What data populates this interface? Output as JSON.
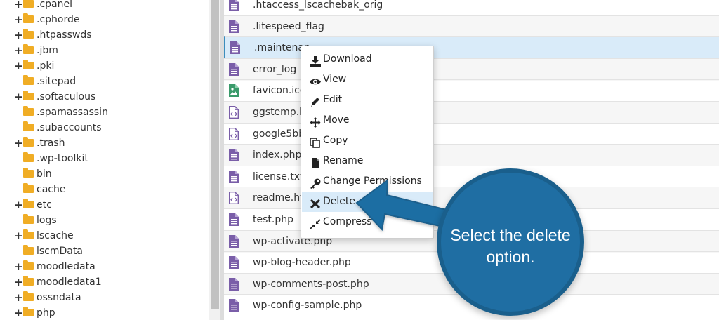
{
  "tree": {
    "items": [
      {
        "label": ".cpanel",
        "expandable": true
      },
      {
        "label": ".cphorde",
        "expandable": true
      },
      {
        "label": ".htpasswds",
        "expandable": true
      },
      {
        "label": ".jbm",
        "expandable": true
      },
      {
        "label": ".pki",
        "expandable": true
      },
      {
        "label": ".sitepad",
        "expandable": false
      },
      {
        "label": ".softaculous",
        "expandable": true
      },
      {
        "label": ".spamassassin",
        "expandable": false
      },
      {
        "label": ".subaccounts",
        "expandable": false
      },
      {
        "label": ".trash",
        "expandable": true
      },
      {
        "label": ".wp-toolkit",
        "expandable": false
      },
      {
        "label": "bin",
        "expandable": false
      },
      {
        "label": "cache",
        "expandable": false
      },
      {
        "label": "etc",
        "expandable": true
      },
      {
        "label": "logs",
        "expandable": false
      },
      {
        "label": "lscache",
        "expandable": true
      },
      {
        "label": "lscmData",
        "expandable": false
      },
      {
        "label": "moodledata",
        "expandable": true
      },
      {
        "label": "moodledata1",
        "expandable": true
      },
      {
        "label": "ossndata",
        "expandable": true
      },
      {
        "label": "php",
        "expandable": true
      }
    ],
    "expand_glyph": "+"
  },
  "files": [
    {
      "name": ".htaccess_lscachebak_orig",
      "icon": "text-file-icon"
    },
    {
      "name": ".litespeed_flag",
      "icon": "text-file-icon"
    },
    {
      "name": ".maintenan",
      "icon": "text-file-icon",
      "selected": true
    },
    {
      "name": "error_log",
      "icon": "text-file-icon"
    },
    {
      "name": "favicon.ico",
      "icon": "image-file-icon"
    },
    {
      "name": "ggstemp.ht",
      "icon": "code-file-icon"
    },
    {
      "name": "google5bb4",
      "icon": "code-file-icon"
    },
    {
      "name": "index.php",
      "icon": "text-file-icon"
    },
    {
      "name": "license.txt",
      "icon": "text-file-icon"
    },
    {
      "name": "readme.htr",
      "icon": "code-file-icon"
    },
    {
      "name": "test.php",
      "icon": "text-file-icon"
    },
    {
      "name": "wp-activate.php",
      "icon": "text-file-icon"
    },
    {
      "name": "wp-blog-header.php",
      "icon": "text-file-icon"
    },
    {
      "name": "wp-comments-post.php",
      "icon": "text-file-icon"
    },
    {
      "name": "wp-config-sample.php",
      "icon": "text-file-icon"
    }
  ],
  "context_menu": {
    "items": [
      {
        "label": "Download",
        "icon": "download-icon"
      },
      {
        "label": "View",
        "icon": "eye-icon"
      },
      {
        "label": "Edit",
        "icon": "pencil-icon"
      },
      {
        "label": "Move",
        "icon": "move-arrows-icon"
      },
      {
        "label": "Copy",
        "icon": "copy-icon"
      },
      {
        "label": "Rename",
        "icon": "file-icon"
      },
      {
        "label": "Change Permissions",
        "icon": "key-icon"
      },
      {
        "label": "Delete",
        "icon": "x-icon",
        "highlighted": true
      },
      {
        "label": "Compress",
        "icon": "compress-icon"
      }
    ]
  },
  "callout": {
    "text": "Select the delete option.",
    "color": "#1f6ea3"
  },
  "colors": {
    "folder": "#f0ad25",
    "file_icon": "#7a5ea8",
    "image_icon": "#3a9a6a",
    "selection": "#d9ebf9"
  }
}
